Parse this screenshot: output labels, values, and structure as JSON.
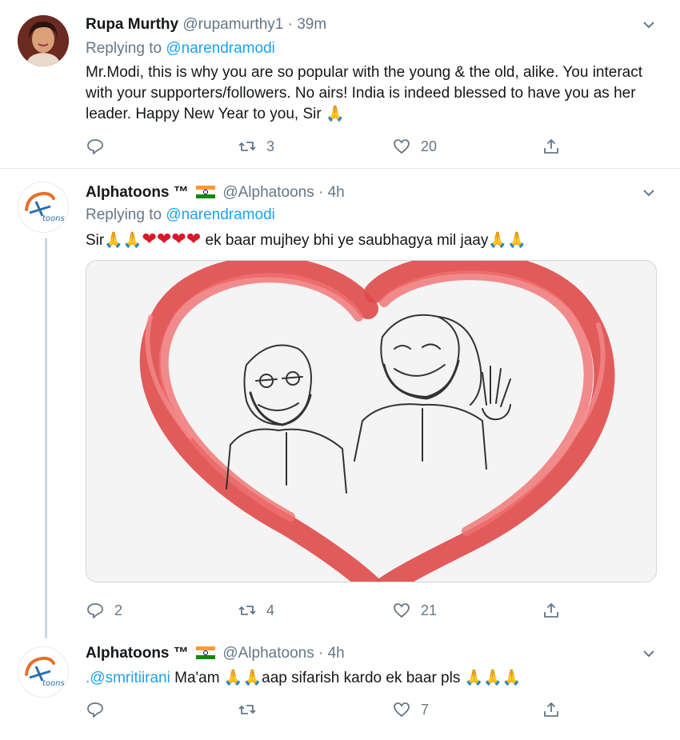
{
  "tweets": [
    {
      "name": "Rupa Murthy",
      "handle": "@rupamurthy1",
      "dot": "·",
      "time": "39m",
      "replying_prefix": "Replying to",
      "replying_to": "@narendramodi",
      "text": "Mr.Modi, this is why you are so popular with the young & the old, alike. You interact with your supporters/followers. No airs! India is indeed blessed to have you as her leader. Happy New Year to you, Sir 🙏",
      "replies": "",
      "retweets": "3",
      "likes": "20"
    },
    {
      "name": "Alphatoons ™",
      "handle": "@Alphatoons",
      "dot": "·",
      "time": "4h",
      "replying_prefix": "Replying to",
      "replying_to": "@narendramodi",
      "text_pre": "Sir🙏🙏",
      "hearts": "❤❤❤❤",
      "text_post": " ek baar mujhey bhi ye saubhagya mil jaay🙏🙏",
      "replies": "2",
      "retweets": "4",
      "likes": "21"
    },
    {
      "name": "Alphatoons ™",
      "handle": "@Alphatoons",
      "dot": "·",
      "time": "4h",
      "mention": ".@smritiirani",
      "text": " Ma'am 🙏🙏aap sifarish kardo ek baar pls 🙏🙏🙏",
      "replies": "",
      "retweets": "",
      "likes": "7"
    }
  ],
  "colors": {
    "link": "#1da1f2",
    "muted": "#657786",
    "divider": "#e1e8ed",
    "heart_red": "#e53935"
  },
  "icons": [
    "reply-icon",
    "retweet-icon",
    "like-icon",
    "share-icon",
    "chevron-down-icon",
    "india-flag-icon"
  ]
}
